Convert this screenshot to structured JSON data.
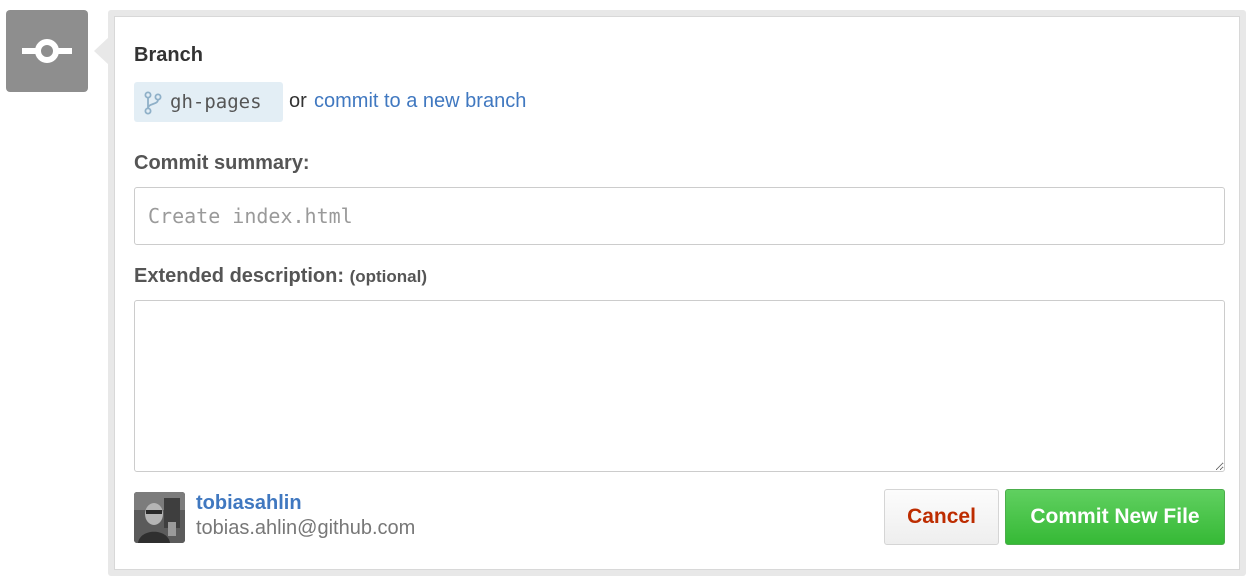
{
  "branch": {
    "heading": "Branch",
    "current_branch": "gh-pages",
    "or_text": "or",
    "new_branch_link": "commit to a new branch"
  },
  "commit_summary": {
    "label": "Commit summary:",
    "placeholder": "Create index.html",
    "value": ""
  },
  "extended_description": {
    "label": "Extended description:",
    "optional_label": "(optional)",
    "value": ""
  },
  "author": {
    "username": "tobiasahlin",
    "email": "tobias.ahlin@github.com"
  },
  "actions": {
    "cancel_label": "Cancel",
    "commit_label": "Commit New File"
  },
  "icons": {
    "commit": "git-commit-icon",
    "branch": "git-branch-icon",
    "resize": "resize-handle-icon"
  },
  "colors": {
    "link": "#4078c0",
    "cancel_text": "#bd2c00",
    "commit_button": "#3cbf3c",
    "commit_icon_bg": "#8e8e8e",
    "branch_pill_bg": "#e3eef5"
  }
}
